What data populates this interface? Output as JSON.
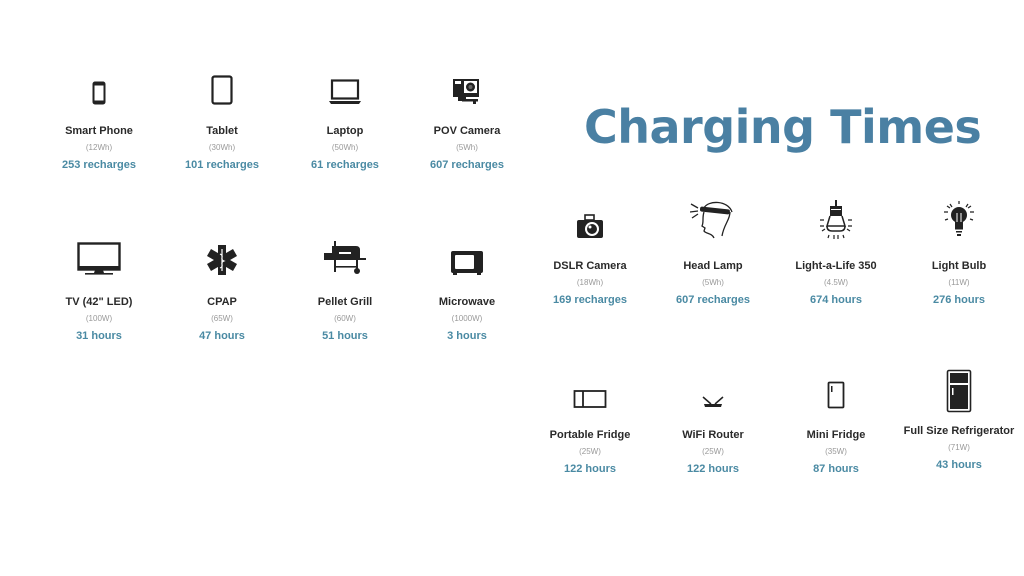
{
  "title": "Charging Times",
  "accent_color": "#4a80a3",
  "devices": [
    {
      "name": "Smart Phone",
      "icon": "smartphone-icon",
      "watts": "(12Wh)",
      "result": "253 recharges"
    },
    {
      "name": "Tablet",
      "icon": "tablet-icon",
      "watts": "(30Wh)",
      "result": "101 recharges"
    },
    {
      "name": "Laptop",
      "icon": "laptop-icon",
      "watts": "(50Wh)",
      "result": "61 recharges"
    },
    {
      "name": "POV Camera",
      "icon": "action-camera-icon",
      "watts": "(5Wh)",
      "result": "607 recharges"
    },
    {
      "name": "TV (42\" LED)",
      "icon": "tv-icon",
      "watts": "(100W)",
      "result": "31 hours"
    },
    {
      "name": "CPAP",
      "icon": "medical-star-icon",
      "watts": "(65W)",
      "result": "47 hours"
    },
    {
      "name": "Pellet Grill",
      "icon": "grill-icon",
      "watts": "(60W)",
      "result": "51 hours"
    },
    {
      "name": "Microwave",
      "icon": "microwave-icon",
      "watts": "(1000W)",
      "result": "3 hours"
    },
    {
      "name": "DSLR Camera",
      "icon": "camera-icon",
      "watts": "(18Wh)",
      "result": "169 recharges"
    },
    {
      "name": "Head Lamp",
      "icon": "headlamp-icon",
      "watts": "(5Wh)",
      "result": "607 recharges"
    },
    {
      "name": "Light-a-Life 350",
      "icon": "pendant-light-icon",
      "watts": "(4.5W)",
      "result": "674 hours"
    },
    {
      "name": "Light Bulb",
      "icon": "light-bulb-icon",
      "watts": "(11W)",
      "result": "276 hours"
    },
    {
      "name": "Portable Fridge",
      "icon": "portable-fridge-icon",
      "watts": "(25W)",
      "result": "122 hours"
    },
    {
      "name": "WiFi Router",
      "icon": "router-icon",
      "watts": "(25W)",
      "result": "122 hours"
    },
    {
      "name": "Mini Fridge",
      "icon": "mini-fridge-icon",
      "watts": "(35W)",
      "result": "87 hours"
    },
    {
      "name": "Full Size Refrigerator",
      "icon": "refrigerator-icon",
      "watts": "(71W)",
      "result": "43 hours"
    }
  ]
}
